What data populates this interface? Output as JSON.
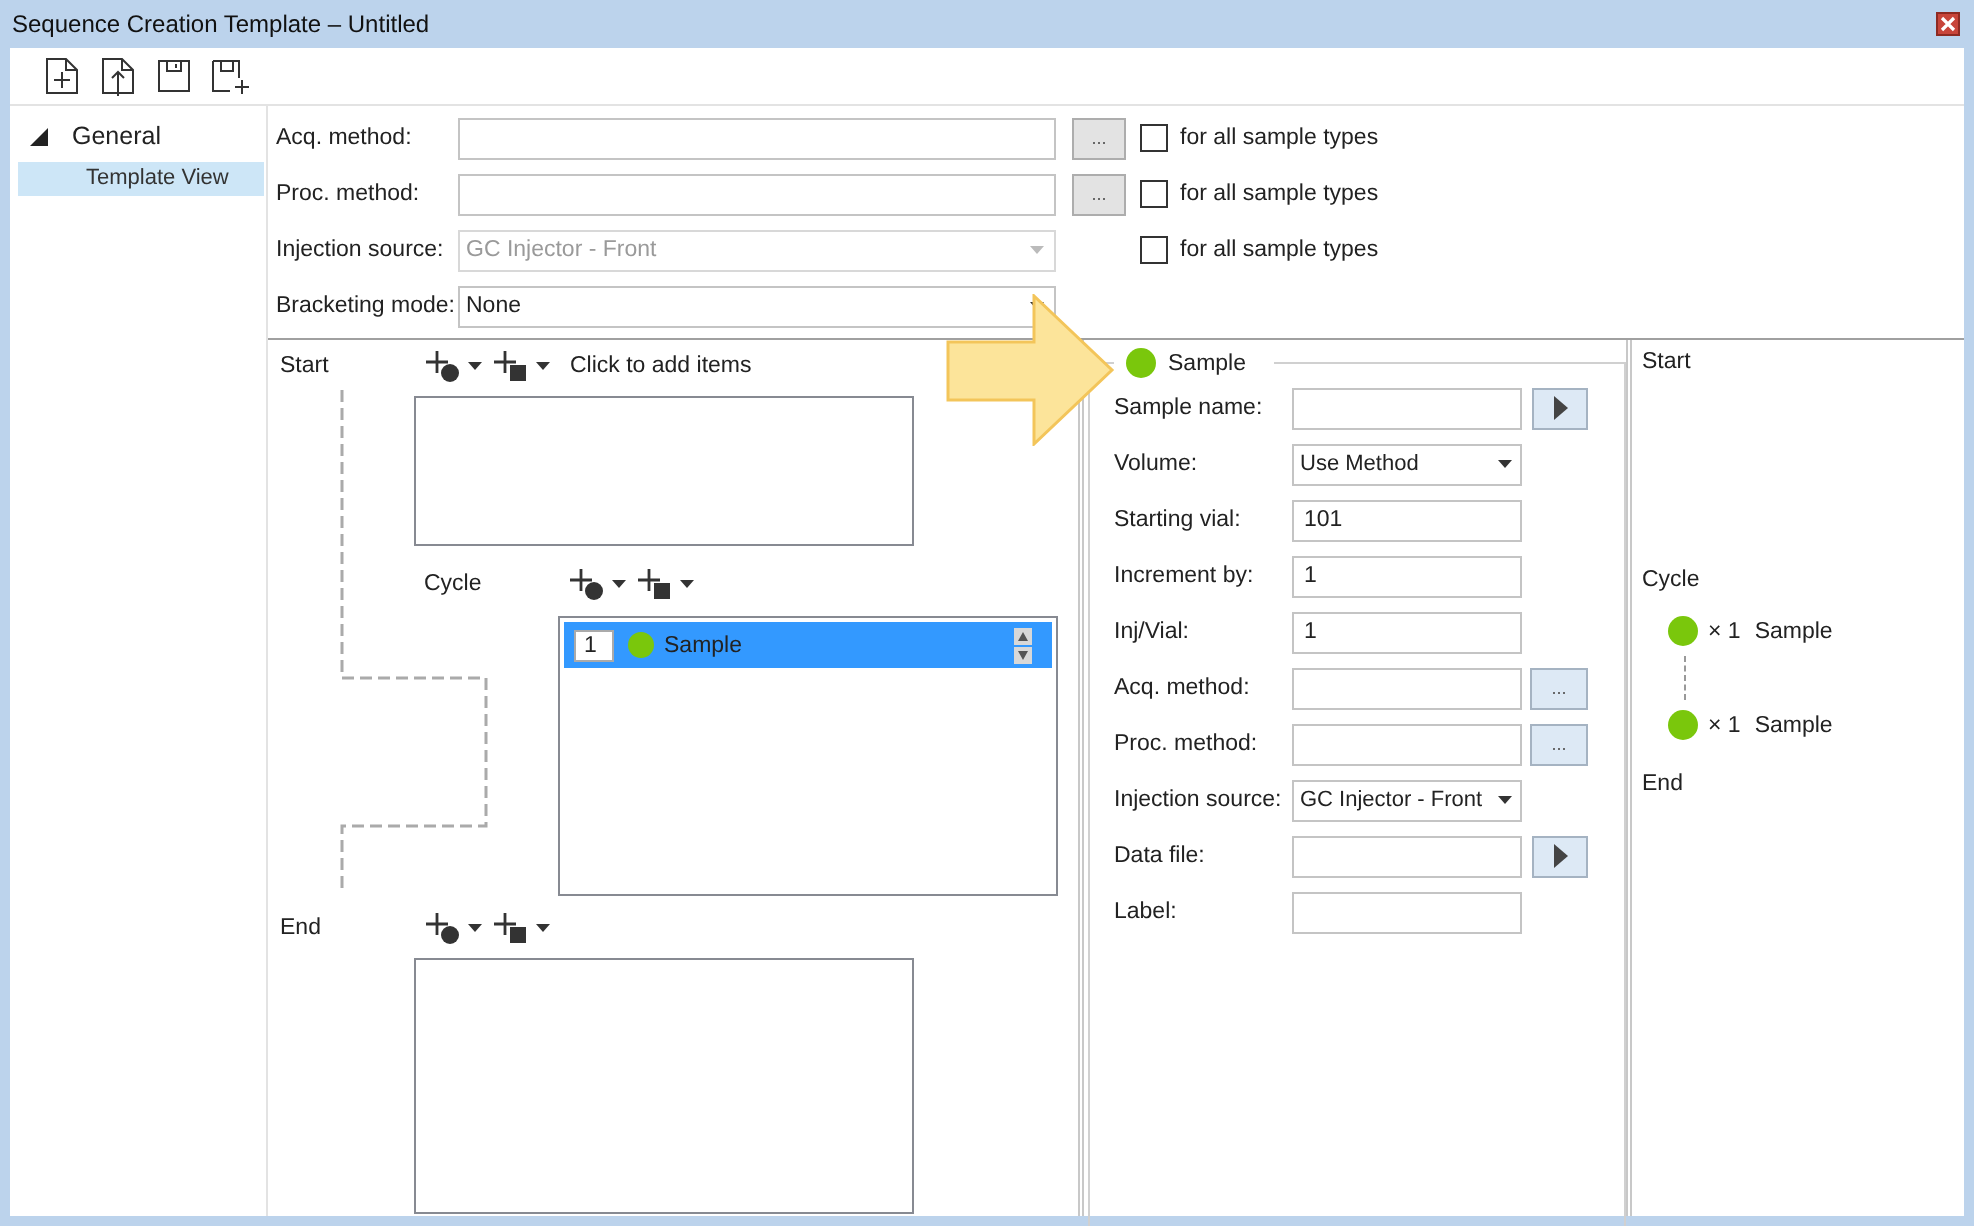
{
  "window": {
    "title": "Sequence Creation Template – Untitled"
  },
  "sidebar": {
    "items": [
      {
        "label": "General",
        "expanded": true,
        "children": [
          {
            "label": "Template View",
            "selected": true
          }
        ]
      }
    ]
  },
  "form": [
    {
      "label": "Acq. method:",
      "kind": "browse",
      "button": "...",
      "disabled": false,
      "all_types": {
        "label": "for all sample types",
        "checked": false
      }
    },
    {
      "label": "Proc. method:",
      "kind": "browse",
      "button": "...",
      "disabled": false,
      "all_types": {
        "label": "for all sample types",
        "checked": false
      }
    },
    {
      "label": "Injection source:",
      "kind": "dropdown",
      "value": "GC Injector - Front",
      "disabled": true,
      "all_types": {
        "label": "for all sample types",
        "checked": false
      }
    },
    {
      "label": "Bracketing mode:",
      "kind": "dropdown",
      "value": "None",
      "disabled": false
    }
  ],
  "flow": {
    "start": {
      "label": "Start",
      "hint": "Click to add items"
    },
    "cycle": {
      "label": "Cycle",
      "items": [
        {
          "index": "1",
          "name": "Sample",
          "color": "#7ac70c",
          "selected": true
        }
      ]
    },
    "end": {
      "label": "End"
    }
  },
  "sample_panel": {
    "title": "Sample",
    "color": "#7ac70c",
    "fields": [
      {
        "label": "Sample name:",
        "kind": "run"
      },
      {
        "label": "Volume:",
        "kind": "dropdown",
        "value": "Use Method"
      },
      {
        "label": "Starting vial:",
        "kind": "text",
        "value": "101"
      },
      {
        "label": "Increment by:",
        "kind": "text",
        "value": "1"
      },
      {
        "label": "Inj/Vial:",
        "kind": "text",
        "value": "1"
      },
      {
        "label": "Acq. method:",
        "kind": "browse",
        "button": "..."
      },
      {
        "label": "Proc. method:",
        "kind": "browse",
        "button": "..."
      },
      {
        "label": "Injection source:",
        "kind": "dropdown",
        "value": "GC Injector - Front"
      },
      {
        "label": "Data file:",
        "kind": "run"
      },
      {
        "label": "Label:",
        "kind": "text"
      }
    ]
  },
  "summary": {
    "start": "Start",
    "cycle": "Cycle",
    "items": [
      {
        "count": "× 1",
        "name": "Sample",
        "color": "#7ac70c"
      },
      {
        "count": "× 1",
        "name": "Sample",
        "color": "#7ac70c"
      }
    ],
    "end": "End"
  }
}
